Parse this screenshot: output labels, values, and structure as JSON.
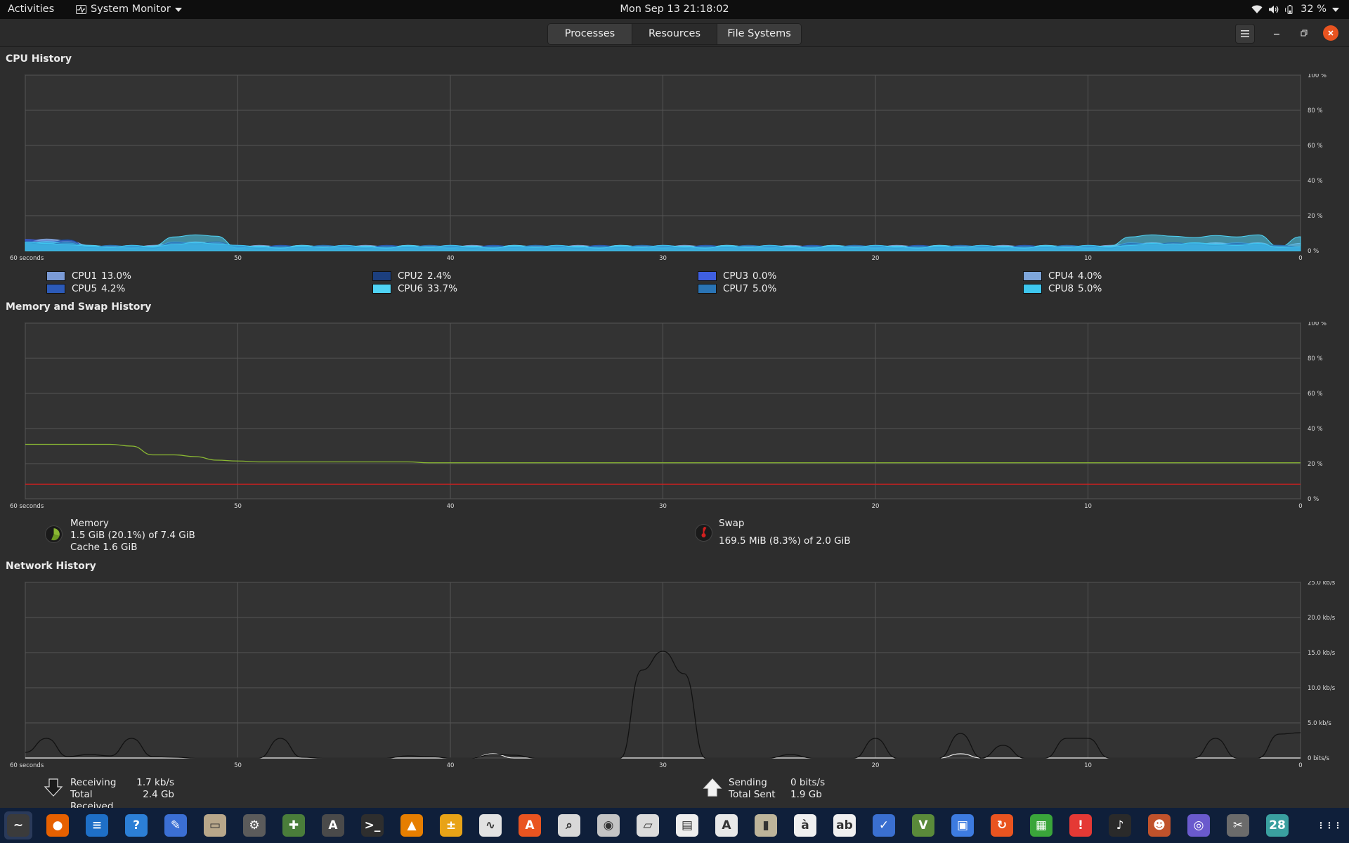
{
  "topbar": {
    "activities": "Activities",
    "app_name": "System Monitor",
    "clock": "Mon Sep 13  21:18:02",
    "battery": "32 %"
  },
  "tabs": [
    {
      "label": "Processes"
    },
    {
      "label": "Resources"
    },
    {
      "label": "File Systems"
    }
  ],
  "active_tab": "Resources",
  "time_axis": {
    "start_label": "60 seconds",
    "labels": [
      "50",
      "40",
      "30",
      "20",
      "10",
      "0"
    ]
  },
  "cpu": {
    "title": "CPU History",
    "y_ticks": [
      "100 %",
      "80 %",
      "60 %",
      "40 %",
      "20 %",
      "0 %"
    ],
    "cores": [
      {
        "name": "CPU1",
        "value": "13.0%",
        "color": "#7b9bd6"
      },
      {
        "name": "CPU2",
        "value": "2.4%",
        "color": "#1c3f7e"
      },
      {
        "name": "CPU3",
        "value": "0.0%",
        "color": "#3f5fe0"
      },
      {
        "name": "CPU4",
        "value": "4.0%",
        "color": "#7ea6da"
      },
      {
        "name": "CPU5",
        "value": "4.2%",
        "color": "#2c5ab8"
      },
      {
        "name": "CPU6",
        "value": "33.7%",
        "color": "#4fd3f5"
      },
      {
        "name": "CPU7",
        "value": "5.0%",
        "color": "#2a74b5"
      },
      {
        "name": "CPU8",
        "value": "5.0%",
        "color": "#3ec7ef"
      }
    ]
  },
  "memory": {
    "title": "Memory and Swap History",
    "y_ticks": [
      "100 %",
      "80 %",
      "60 %",
      "40 %",
      "20 %",
      "0 %"
    ],
    "mem_label": "Memory",
    "mem_line1": "1.5 GiB (20.1%) of 7.4 GiB",
    "mem_line2": "Cache 1.6 GiB",
    "mem_color": "#8ab833",
    "swap_label": "Swap",
    "swap_line1": "169.5 MiB (8.3%) of 2.0 GiB",
    "swap_color": "#d11f1f",
    "memory_percent_series": [
      31,
      31,
      31,
      31,
      31,
      30,
      25,
      25,
      24,
      22,
      21.5,
      21,
      21,
      21,
      21,
      21,
      21,
      21,
      21,
      20.5,
      20.5,
      20.5,
      20.5,
      20.5,
      20.5,
      20.5,
      20.5,
      20.5,
      20.5,
      20.5,
      20.5,
      20.5,
      20.5,
      20.5,
      20.5,
      20.5,
      20.5,
      20.5,
      20.5,
      20.5,
      20.5,
      20.5,
      20.5,
      20.5,
      20.5,
      20.5,
      20.5,
      20.5,
      20.5,
      20.5,
      20.5,
      20.5,
      20.5,
      20.5,
      20.5,
      20.5,
      20.5,
      20.5,
      20.5,
      20.5,
      20.5
    ],
    "swap_percent_series": [
      8.3,
      8.3,
      8.3,
      8.3,
      8.3,
      8.3,
      8.3,
      8.3,
      8.3,
      8.3,
      8.3,
      8.3,
      8.3,
      8.3,
      8.3,
      8.3,
      8.3,
      8.3,
      8.3,
      8.3,
      8.3,
      8.3,
      8.3,
      8.3,
      8.3,
      8.3,
      8.3,
      8.3,
      8.3,
      8.3,
      8.3,
      8.3,
      8.3,
      8.3,
      8.3,
      8.3,
      8.3,
      8.3,
      8.3,
      8.3,
      8.3,
      8.3,
      8.3,
      8.3,
      8.3,
      8.3,
      8.3,
      8.3,
      8.3,
      8.3,
      8.3,
      8.3,
      8.3,
      8.3,
      8.3,
      8.3,
      8.3,
      8.3,
      8.3,
      8.3,
      8.3
    ]
  },
  "network": {
    "title": "Network History",
    "y_ticks": [
      "25.0 kb/s",
      "20.0 kb/s",
      "15.0 kb/s",
      "10.0 kb/s",
      "5.0 kb/s",
      "0 bits/s"
    ],
    "receiving_label": "Receiving",
    "receiving_value": "1.7 kb/s",
    "total_received_label": "Total Received",
    "total_received_value": "2.4 Gb",
    "sending_label": "Sending",
    "sending_value": "0 bits/s",
    "total_sent_label": "Total Sent",
    "total_sent_value": "1.9 Gb",
    "receive_kbps_series": [
      0.8,
      2.8,
      0.2,
      0.5,
      0.3,
      2.8,
      0.2,
      0.1,
      0,
      0,
      0,
      0,
      2.8,
      0.1,
      0,
      0,
      0,
      0,
      0.3,
      0.2,
      0,
      0,
      0.5,
      0.4,
      0,
      0,
      0,
      0,
      0,
      12.5,
      15.2,
      12.0,
      0,
      0,
      0,
      0,
      0.5,
      0,
      0,
      0,
      2.8,
      0,
      0,
      0,
      3.5,
      0,
      1.8,
      0,
      0,
      2.8,
      2.8,
      0,
      0,
      0,
      0,
      0,
      2.8,
      0,
      0,
      3.4,
      3.6
    ],
    "send_kbps_series": [
      0,
      0,
      0,
      0,
      0,
      0,
      0,
      0,
      0,
      0,
      0,
      0,
      0,
      0,
      0,
      0,
      0,
      0,
      0,
      0,
      0,
      0,
      0.6,
      0,
      0,
      0,
      0,
      0,
      0,
      0,
      0,
      0,
      0,
      0,
      0,
      0,
      0,
      0,
      0,
      0,
      0,
      0,
      0,
      0,
      0.6,
      0,
      0,
      0,
      0,
      0,
      0,
      0,
      0,
      0,
      0,
      0,
      0,
      0,
      0,
      0,
      0
    ]
  },
  "dock": [
    {
      "name": "system-monitor",
      "color": "#3b3b3b",
      "glyph": "~"
    },
    {
      "name": "firefox",
      "color": "#e66000",
      "glyph": "●"
    },
    {
      "name": "writer",
      "color": "#1e6fc7",
      "glyph": "≡"
    },
    {
      "name": "help",
      "color": "#2c7fd6",
      "glyph": "?"
    },
    {
      "name": "text-editor",
      "color": "#3b6fd4",
      "glyph": "✎"
    },
    {
      "name": "files",
      "color": "#b8a78a",
      "glyph": "▭"
    },
    {
      "name": "settings",
      "color": "#5b5b5b",
      "glyph": "⚙"
    },
    {
      "name": "extensions",
      "color": "#4a7d3a",
      "glyph": "✚"
    },
    {
      "name": "software-center",
      "color": "#4a4a4a",
      "glyph": "A"
    },
    {
      "name": "terminal",
      "color": "#2e2e2e",
      "glyph": ">_"
    },
    {
      "name": "vlc",
      "color": "#e67e00",
      "glyph": "▲"
    },
    {
      "name": "calculator",
      "color": "#e8a317",
      "glyph": "±"
    },
    {
      "name": "activity-monitor",
      "color": "#e2e2e2",
      "glyph": "∿"
    },
    {
      "name": "app-store",
      "color": "#e95420",
      "glyph": "A"
    },
    {
      "name": "image-viewer",
      "color": "#d8d8d8",
      "glyph": "⌕"
    },
    {
      "name": "disk-usage",
      "color": "#c4c4c4",
      "glyph": "◉"
    },
    {
      "name": "document-scanner",
      "color": "#dcdcdc",
      "glyph": "▱"
    },
    {
      "name": "certificates",
      "color": "#eeeeee",
      "glyph": "▤"
    },
    {
      "name": "pdf-viewer",
      "color": "#e8e8e8",
      "glyph": "A"
    },
    {
      "name": "archive-manager",
      "color": "#bdb49a",
      "glyph": "▮"
    },
    {
      "name": "character-map",
      "color": "#f0f0f0",
      "glyph": "à"
    },
    {
      "name": "fonts",
      "color": "#f0f0f0",
      "glyph": "ab"
    },
    {
      "name": "todo",
      "color": "#3a6fd0",
      "glyph": "✓"
    },
    {
      "name": "vim",
      "color": "#5a8a3a",
      "glyph": "V"
    },
    {
      "name": "screenshot",
      "color": "#3d7be0",
      "glyph": "▣"
    },
    {
      "name": "updater",
      "color": "#e95420",
      "glyph": "↻"
    },
    {
      "name": "spreadsheet",
      "color": "#3aa53a",
      "glyph": "▦"
    },
    {
      "name": "alert",
      "color": "#e53935",
      "glyph": "!"
    },
    {
      "name": "music",
      "color": "#2a2a2a",
      "glyph": "♪"
    },
    {
      "name": "game",
      "color": "#c0522b",
      "glyph": "☻"
    },
    {
      "name": "camera",
      "color": "#6a5acd",
      "glyph": "◎"
    },
    {
      "name": "gimp",
      "color": "#6b6b6b",
      "glyph": "✂"
    },
    {
      "name": "calendar",
      "color": "#3aa0a0",
      "glyph": "28"
    },
    {
      "name": "show-apps",
      "color": "transparent",
      "glyph": "⋮⋮⋮"
    }
  ]
}
